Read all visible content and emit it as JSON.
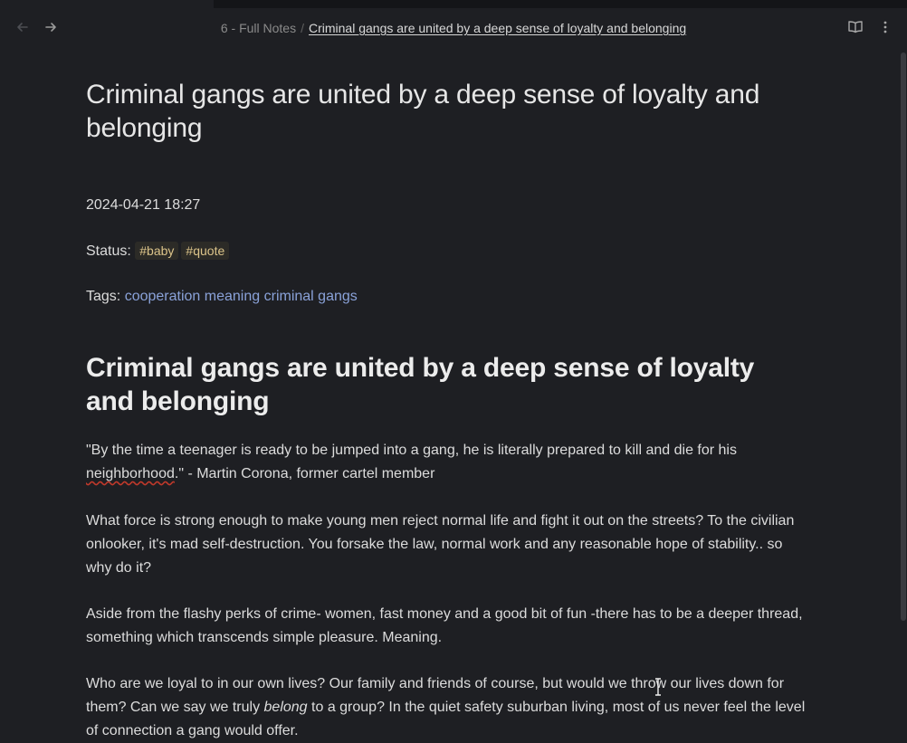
{
  "header": {
    "breadcrumb_parent": "6 - Full Notes",
    "breadcrumb_separator": "/",
    "breadcrumb_current": "Criminal gangs are united by a deep sense of loyalty and belonging"
  },
  "icons": {
    "back": "arrow-left-icon",
    "forward": "arrow-right-icon",
    "reading_mode": "book-open-icon",
    "more": "more-options-icon"
  },
  "note": {
    "title": "Criminal gangs are united by a deep sense of loyalty and belonging",
    "date": "2024-04-21 18:27",
    "status_label": "Status:",
    "status_tags": [
      "#baby",
      "#quote"
    ],
    "tags_label": "Tags:",
    "tags_links": [
      "cooperation",
      "meaning",
      "criminal gangs"
    ],
    "heading": "Criminal gangs are united by a deep sense of loyalty and belonging",
    "quote_part1": "\"By the time a teenager is ready to be jumped into a gang, he is literally prepared to kill and die for his ",
    "quote_misspelled": "neighborhood",
    "quote_part2": ".\" - Martin Corona, former cartel member",
    "para2": "What force is strong enough to make young men reject normal life and fight it out on the streets? To the civilian onlooker, it's mad self-destruction. You forsake the law, normal work and any reasonable hope of stability.. so why do it?",
    "para3": "Aside from the flashy perks of crime- women, fast money and a good bit of fun -there has to be a deeper thread, something which transcends simple pleasure. Meaning.",
    "para4_a": "Who are we loyal to in our own lives? Our family and friends of course, but would we throw our lives down for them? Can we say we truly ",
    "para4_em": "belong",
    "para4_b": " to a group? In the quiet safety suburban living, most of us never feel the level of connection a gang would offer."
  },
  "colors": {
    "background": "#1e1f23",
    "tag_text": "#dcc48a",
    "link": "#8aa2d9"
  }
}
